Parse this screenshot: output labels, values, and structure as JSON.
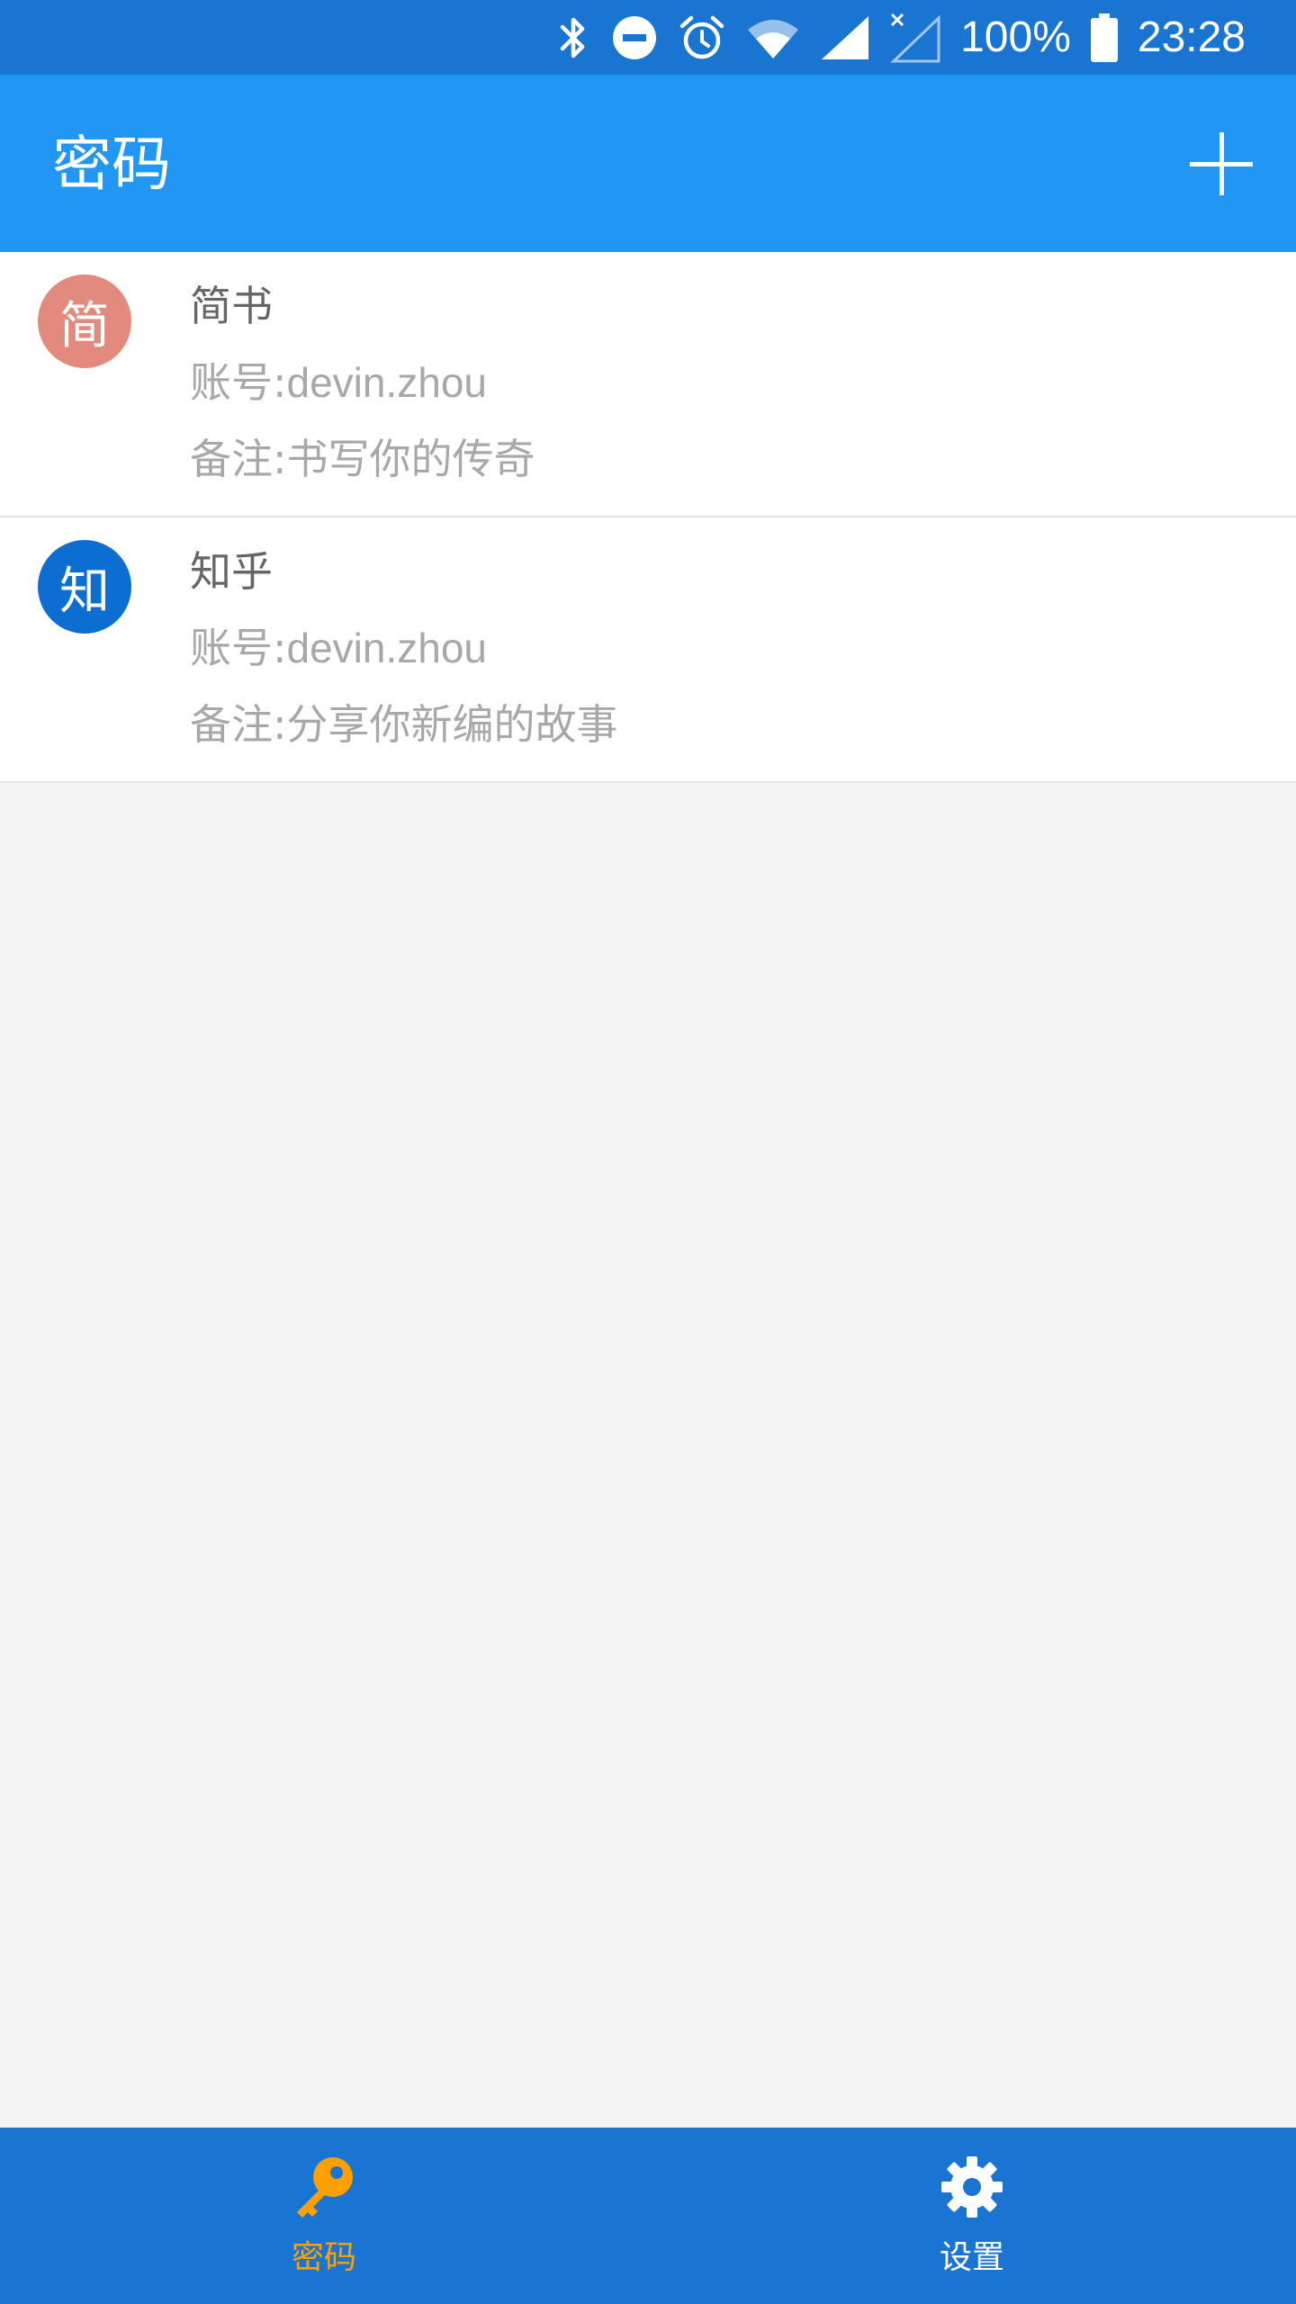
{
  "status_bar": {
    "battery": "100%",
    "time": "23:28"
  },
  "app_bar": {
    "title": "密码",
    "add_icon": "plus-icon"
  },
  "entries": [
    {
      "avatar_char": "简",
      "avatar_color": "#e28a7d",
      "name": "简书",
      "account_label": "账号:",
      "account": "devin.zhou",
      "note_label": "备注:",
      "note": "书写你的传奇"
    },
    {
      "avatar_char": "知",
      "avatar_color": "#0c6ed1",
      "name": "知乎",
      "account_label": "账号:",
      "account": "devin.zhou",
      "note_label": "备注:",
      "note": "分享你新编的故事"
    }
  ],
  "bottom_nav": {
    "items": [
      {
        "label": "密码",
        "icon": "key-icon",
        "active": true
      },
      {
        "label": "设置",
        "icon": "gear-icon",
        "active": false
      }
    ]
  },
  "colors": {
    "status_bar": "#1a75d2",
    "app_bar": "#2196f3",
    "bottom_nav": "#1a75d2",
    "active_tab": "#ffa000",
    "background": "#f4f4f4"
  }
}
